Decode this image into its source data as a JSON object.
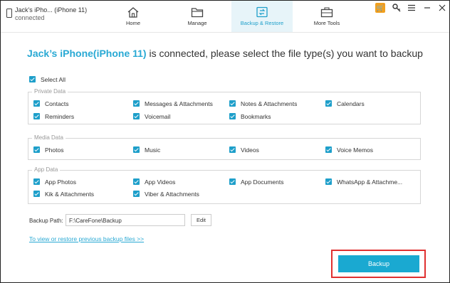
{
  "device": {
    "name": "Jack's iPho... (iPhone 11)",
    "status": "connected"
  },
  "nav": [
    {
      "label": "Home",
      "icon": "home-icon"
    },
    {
      "label": "Manage",
      "icon": "folder-icon"
    },
    {
      "label": "Backup & Restore",
      "icon": "backup-restore-icon",
      "active": true
    },
    {
      "label": "More Tools",
      "icon": "toolbox-icon"
    }
  ],
  "window_icons": [
    "cart-icon",
    "key-icon",
    "menu-icon",
    "minimize-icon",
    "close-icon"
  ],
  "heading": {
    "device": "Jack’s iPhone(iPhone 11)",
    "text": " is connected, please select the file type(s) you want to backup"
  },
  "select_all": "Select All",
  "groups": {
    "private": {
      "title": "Private Data",
      "items": [
        "Contacts",
        "Messages & Attachments",
        "Notes & Attachments",
        "Calendars",
        "Reminders",
        "Voicemail",
        "Bookmarks"
      ]
    },
    "media": {
      "title": "Media Data",
      "items": [
        "Photos",
        "Music",
        "Videos",
        "Voice Memos"
      ]
    },
    "app": {
      "title": "App Data",
      "items": [
        "App Photos",
        "App Videos",
        "App Documents",
        "WhatsApp & Attachme...",
        "Kik & Attachments",
        "Viber & Attachments"
      ]
    }
  },
  "backup_path": {
    "label": "Backup Path:",
    "value": "F:\\CareFone\\Backup",
    "edit": "Edit"
  },
  "view_link": "To view or restore previous backup files >>",
  "backup_button": "Backup",
  "colors": {
    "accent": "#1aa9d1",
    "highlight": "#e03030",
    "cart": "#f0a020"
  }
}
